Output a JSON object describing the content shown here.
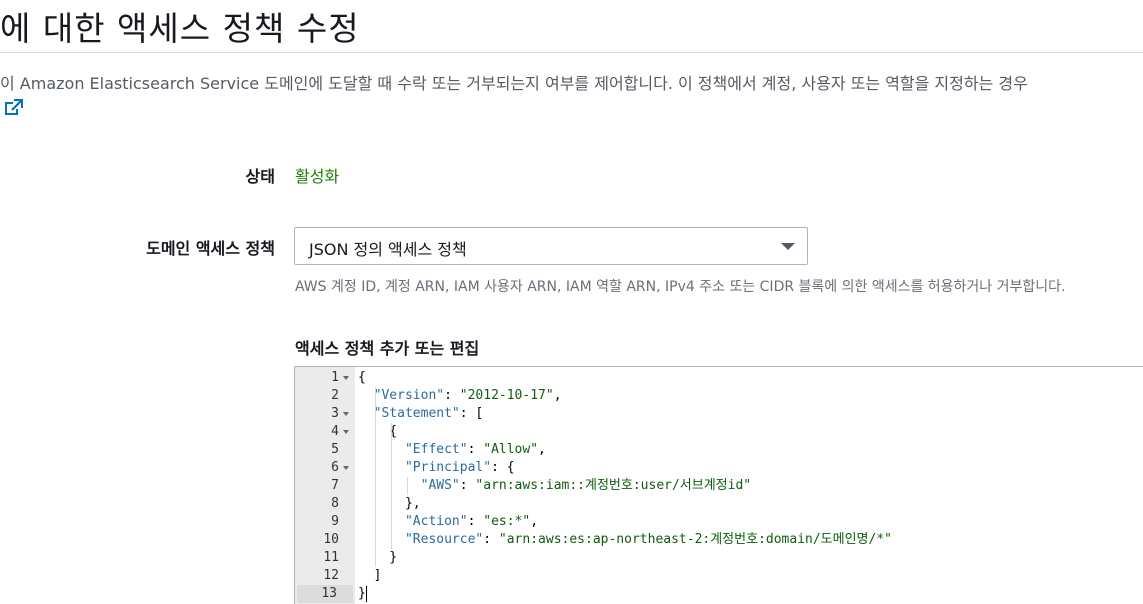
{
  "page": {
    "title": "에 대한 액세스 정책 수정",
    "description": "이 Amazon Elasticsearch Service 도메인에 도달할 때 수락 또는 거부되는지 여부를 제어합니다. 이 정책에서 계정, 사용자 또는 역할을 지정하는 경우"
  },
  "status": {
    "label": "상태",
    "value": "활성화"
  },
  "policy": {
    "label": "도메인 액세스 정책",
    "selected": "JSON 정의 액세스 정책",
    "hint": "AWS 계정 ID, 계정 ARN, IAM 사용자 ARN, IAM 역할 ARN, IPv4 주소 또는 CIDR 블록에 의한 액세스를 허용하거나 거부합니다."
  },
  "editor": {
    "heading": "액세스 정책 추가 또는 편집",
    "active_line": 13,
    "lines": [
      {
        "n": "1",
        "code": "{"
      },
      {
        "n": "2",
        "code": "  \"Version\": \"2012-10-17\","
      },
      {
        "n": "3",
        "code": "  \"Statement\": ["
      },
      {
        "n": "4",
        "code": "    {"
      },
      {
        "n": "5",
        "code": "      \"Effect\": \"Allow\","
      },
      {
        "n": "6",
        "code": "      \"Principal\": {"
      },
      {
        "n": "7",
        "code": "        \"AWS\": \"arn:aws:iam::계정번호:user/서브계정id\""
      },
      {
        "n": "8",
        "code": "      },"
      },
      {
        "n": "9",
        "code": "      \"Action\": \"es:*\","
      },
      {
        "n": "10",
        "code": "      \"Resource\": \"arn:aws:es:ap-northeast-2:계정번호:domain/도메인명/*\""
      },
      {
        "n": "11",
        "code": "    }"
      },
      {
        "n": "12",
        "code": "  ]"
      },
      {
        "n": "13",
        "code": "}"
      }
    ],
    "foldable_lines": [
      1,
      3,
      4,
      6
    ]
  },
  "colors": {
    "accent_green": "#1d8102",
    "json_key": "#2b6ba1",
    "json_string": "#0e5d0e"
  }
}
